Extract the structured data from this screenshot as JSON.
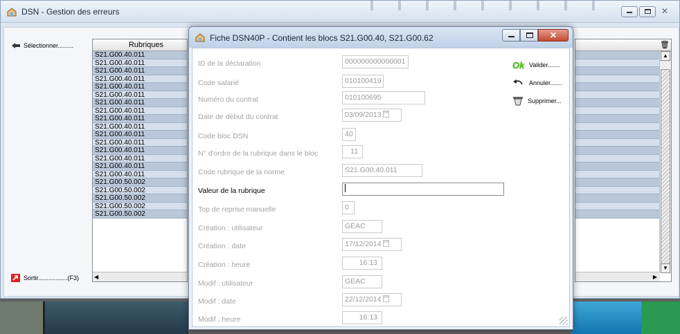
{
  "main_window": {
    "title": "DSN - Gestion des erreurs"
  },
  "left_panel": {
    "select_label": "Sélectionner.........",
    "exit_label": "Sortir.................(F3)"
  },
  "grid": {
    "column_header": "Rubriques",
    "rows": [
      "S21.G00.40.011",
      "S21.G00.40.011",
      "S21.G00.40.011",
      "S21.G00.40.011",
      "S21.G00.40.011",
      "S21.G00.40.011",
      "S21.G00.40.011",
      "S21.G00.40.011",
      "S21.G00.40.011",
      "S21.G00.40.011",
      "S21.G00.40.011",
      "S21.G00.40.011",
      "S21.G00.40.011",
      "S21.G00.40.011",
      "S21.G00.40.011",
      "S21.G00.40.011",
      "S21.G00.50.002",
      "S21.G00.50.002",
      "S21.G00.50.002",
      "S21.G00.50.002",
      "S21.G00.50.002"
    ]
  },
  "dialog": {
    "title": "Fiche DSN40P - Contient les blocs S21.G00.40, S21.G00.62",
    "fields": [
      {
        "label": "ID de la déclaration",
        "value": "000000000000001"
      },
      {
        "label": "Code salarié",
        "value": "010100419"
      },
      {
        "label": "Numéro du contrat",
        "value": "010100695"
      },
      {
        "label": "Date de début du contrat",
        "value": "03/09/2013"
      },
      {
        "label": "Code bloc DSN",
        "value": "40"
      },
      {
        "label": "N° d'ordre de la rubrique dans le bloc",
        "value": "11"
      },
      {
        "label": "Code rubrique de la norme",
        "value": "S21.G00.40.011"
      },
      {
        "label": "Valeur de la rubrique",
        "value": ""
      },
      {
        "label": "Top de reprise manuelle",
        "value": "0"
      },
      {
        "label": "Création : utilisateur",
        "value": "GEAC"
      },
      {
        "label": "Création : date",
        "value": "17/12/2014"
      },
      {
        "label": "Création : heure",
        "value": "16:13"
      },
      {
        "label": "Modif : utilisateur",
        "value": "GEAC"
      },
      {
        "label": "Modif : date",
        "value": "22/12/2014"
      },
      {
        "label": "Modif : heure",
        "value": "16:13"
      }
    ],
    "actions": {
      "validate_icon_text": "Ok",
      "validate_label": "Valider.......",
      "cancel_label": "Annuler.......",
      "delete_label": "Supprimer..."
    }
  },
  "colors": {
    "row_alt": "#b9c7d9",
    "row_even": "#d6e0ec",
    "close_red": "#c54b32",
    "ok_green": "#4fc21e"
  }
}
